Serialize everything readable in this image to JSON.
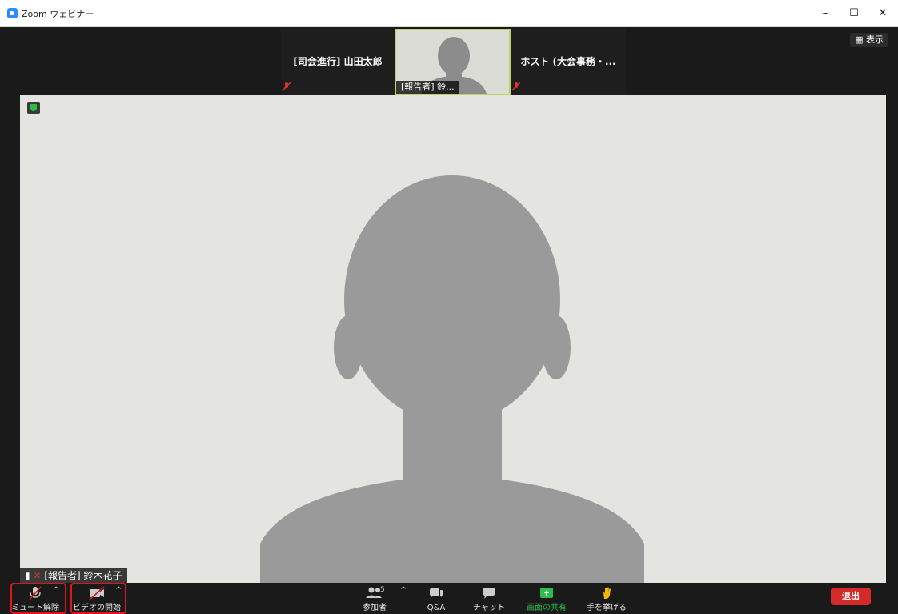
{
  "window": {
    "title": "Zoom ウェビナー",
    "minimize_glyph": "–",
    "maximize_glyph": "☐",
    "close_glyph": "✕"
  },
  "strip": {
    "left_tile_name": "[司会進行] 山田太郎",
    "center_tile_label": "[報告者] 鈴...",
    "right_tile_name": "ホスト (大会事務・...",
    "view_button": "表示"
  },
  "main_video": {
    "speaker_label": "[報告者] 鈴木花子"
  },
  "toolbar": {
    "unmute_label": "ミュート解除",
    "start_video_label": "ビデオの開始",
    "participants_label": "参加者",
    "participants_count": "5",
    "qa_label": "Q&A",
    "chat_label": "チャット",
    "share_label": "画面の共有",
    "raise_hand_label": "手を挙げる",
    "leave_label": "退出"
  },
  "colors": {
    "accent_green": "#2dbb4a",
    "leave_red": "#d62a2a",
    "highlight_red": "#e0141c",
    "zoom_blue": "#2d8cff"
  }
}
